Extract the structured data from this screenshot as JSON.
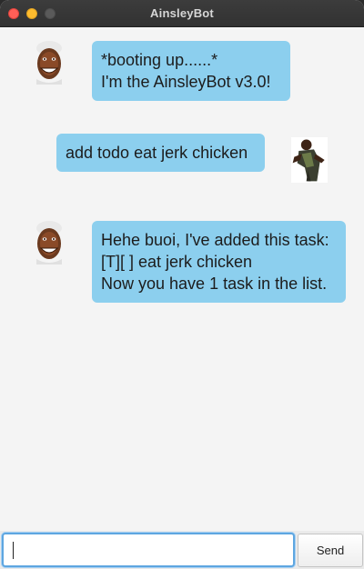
{
  "window": {
    "title": "AinsleyBot"
  },
  "messages": [
    {
      "sender": "bot",
      "lines": [
        "*booting up......*",
        "I'm the AinsleyBot v3.0!"
      ]
    },
    {
      "sender": "user",
      "lines": [
        "add todo eat jerk chicken"
      ]
    },
    {
      "sender": "bot",
      "lines": [
        "Hehe buoi, I've added this task:",
        "[T][ ] eat jerk chicken",
        "Now you have 1 task in the list."
      ]
    }
  ],
  "input": {
    "value": "",
    "placeholder": ""
  },
  "send_button": {
    "label": "Send"
  },
  "colors": {
    "bubble": "#8ccfee",
    "background": "#f4f4f4",
    "focus": "#5ea6e0"
  }
}
